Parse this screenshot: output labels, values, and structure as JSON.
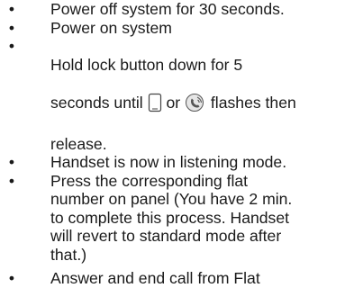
{
  "steps": [
    {
      "text": "Power off system for 30 seconds."
    },
    {
      "text": "Power on system"
    },
    {
      "line1": "Hold lock button down for 5",
      "line2_pre": "seconds until ",
      "line2_mid": " or ",
      "line2_post": " flashes then",
      "line3": "release.",
      "icons": [
        "handset-icon",
        "intercom-icon"
      ]
    },
    {
      "text": "Handset is now in listening mode."
    },
    {
      "text": "Press the corresponding flat\nnumber on panel (You have 2 min.\nto complete this process. Handset\nwill revert to standard mode after\nthat.)"
    },
    {
      "text": "Answer and end call from Flat"
    }
  ],
  "bullet_char": "•"
}
